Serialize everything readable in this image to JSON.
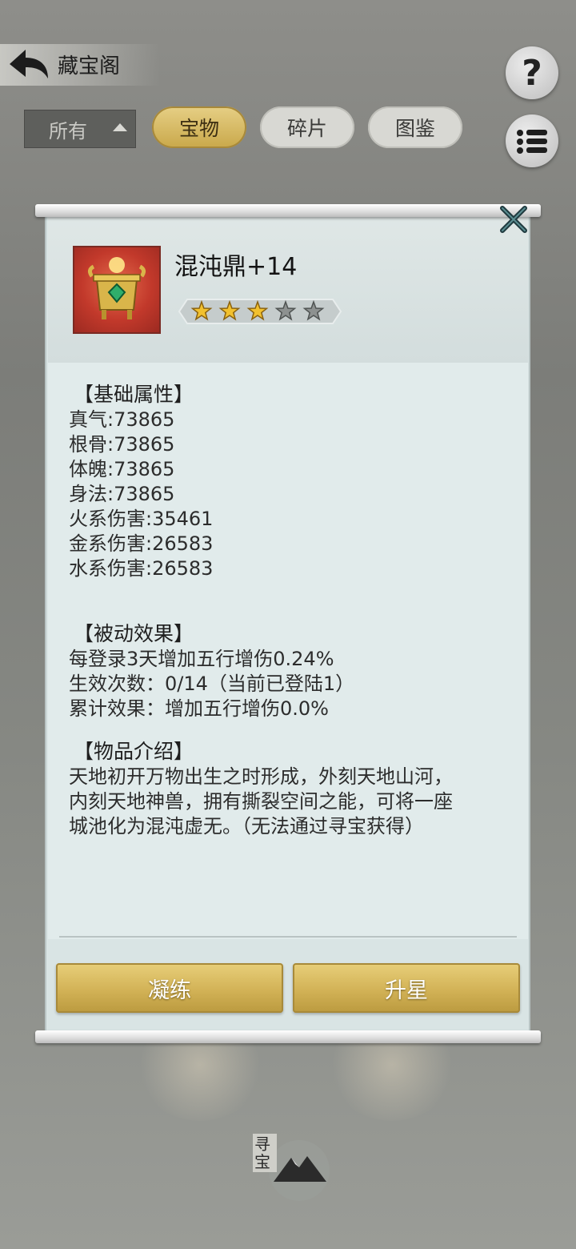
{
  "header": {
    "title": "藏宝阁"
  },
  "filter": {
    "label": "所有"
  },
  "tabs": [
    {
      "label": "宝物",
      "active": true
    },
    {
      "label": "碎片",
      "active": false
    },
    {
      "label": "图鉴",
      "active": false
    }
  ],
  "item": {
    "name": "混沌鼎+14",
    "stars_filled": 3,
    "stars_total": 5
  },
  "sections": {
    "base": {
      "title": "【基础属性】",
      "lines": [
        "真气:73865",
        "根骨:73865",
        "体魄:73865",
        "身法:73865",
        "火系伤害:35461",
        "金系伤害:26583",
        "水系伤害:26583"
      ]
    },
    "passive": {
      "title": "【被动效果】",
      "lines": [
        "每登录3天增加五行增伤0.24%",
        "生效次数：0/14（当前已登陆1）",
        "累计效果：增加五行增伤0.0%"
      ]
    },
    "intro": {
      "title": "【物品介绍】",
      "lines": [
        "天地初开万物出生之时形成，外刻天地山河，",
        "内刻天地神兽，拥有撕裂空间之能，可将一座",
        "城池化为混沌虚无。（无法通过寻宝获得）"
      ]
    }
  },
  "buttons": {
    "refine": "凝练",
    "star_up": "升星"
  },
  "footer": {
    "seal_text": "寻宝"
  },
  "colors": {
    "gold": "#d2b256",
    "dialog_bg": "#e1ebeb",
    "icon_bg": "#c2392b"
  }
}
